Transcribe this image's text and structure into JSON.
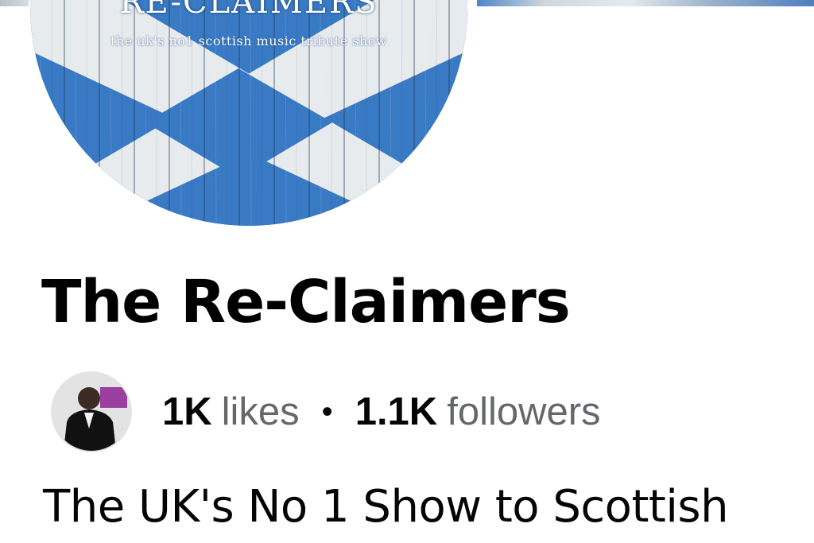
{
  "cover": {
    "description_colors": {
      "flag_blue": "#2f73c2",
      "flag_white": "#e8ecef"
    }
  },
  "profile_picture": {
    "title_text": "RE-CLAIMERS",
    "tagline_text": "the uk's no1 scottish music tribute show"
  },
  "page": {
    "name": "The Re-Claimers",
    "likes_count": "1K",
    "likes_label": "likes",
    "separator": "•",
    "followers_count": "1.1K",
    "followers_label": "followers",
    "intro": "The UK's No 1 Show to Scottish"
  },
  "colors": {
    "primary_text": "#050505",
    "secondary_text": "#65676b",
    "background": "#ffffff"
  }
}
